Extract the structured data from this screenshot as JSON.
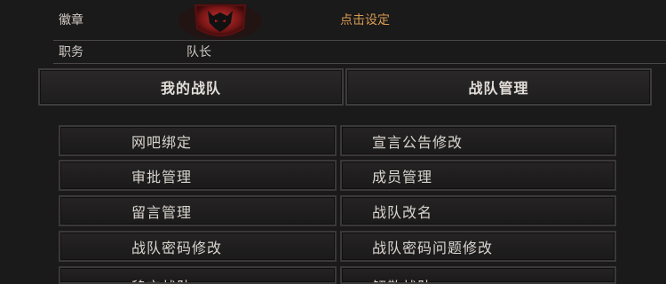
{
  "profile": {
    "emblem_label": "徽章",
    "set_link": "点击设定",
    "position_label": "职务",
    "position_value": "队长"
  },
  "tabs": [
    {
      "label": "我的战队"
    },
    {
      "label": "战队管理"
    }
  ],
  "menu": [
    {
      "label": "网吧绑定"
    },
    {
      "label": "宣言公告修改"
    },
    {
      "label": "审批管理"
    },
    {
      "label": "成员管理"
    },
    {
      "label": "留言管理"
    },
    {
      "label": "战队改名"
    },
    {
      "label": "战队密码修改"
    },
    {
      "label": "战队密码问题修改"
    },
    {
      "label": "移交战队"
    },
    {
      "label": "解散战队"
    }
  ],
  "colors": {
    "background": "#1b1a1a",
    "accent_link": "#d79a52",
    "emblem_red": "#8e1c1c"
  }
}
